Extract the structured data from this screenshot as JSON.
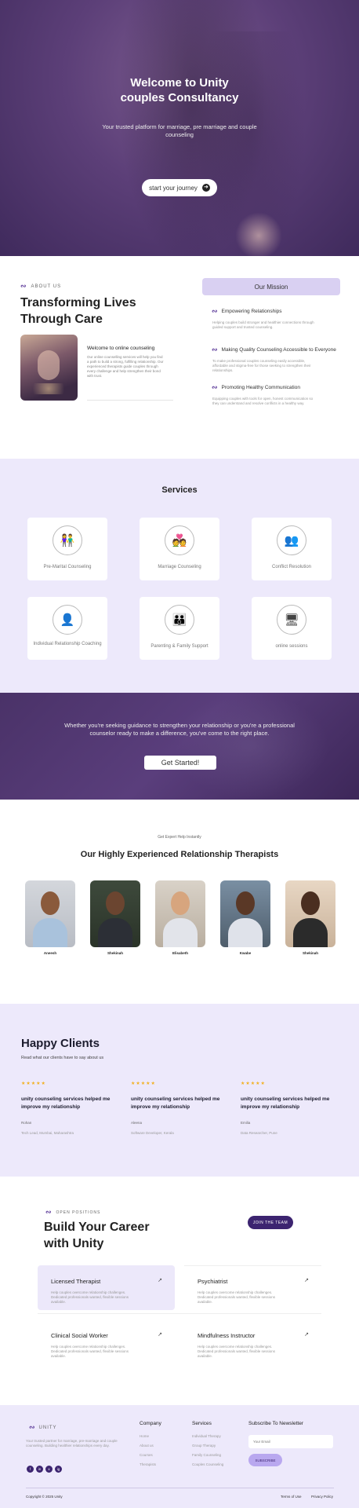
{
  "hero": {
    "title_line1": "Welcome to Unity",
    "title_line2": "couples Consultancy",
    "subtitle": "Your trusted platform for marriage, pre marriage and couple counseling",
    "cta_label": "start your journey",
    "cta_icon": "arrow-right-icon"
  },
  "about": {
    "tag": "ABOUT US",
    "title_line1": "Transforming Lives",
    "title_line2": "Through Care",
    "subheading": "Welcome to online counseling",
    "body": "Our online counselling services will help you find a path to build a strong, fulfilling relationship. Our experienced therapists guide couples through every challenge and help strengthen their bond with trust.",
    "mission_label": "Our Mission",
    "mission_items": [
      {
        "title": "Empowering Relationships",
        "text": "Helping couples build stronger and healthier connections through guided support and trusted counseling."
      },
      {
        "title": "Making Quality Counseling Accessible to Everyone",
        "text": "To make professional couples counseling easily accessible, affordable and stigma-free for those seeking to strengthen their relationships."
      },
      {
        "title": "Promoting Healthy Communication",
        "text": "Equipping couples with tools for open, honest communication so they can understand and resolve conflicts in a healthy way."
      }
    ]
  },
  "services": {
    "title": "Services",
    "items": [
      {
        "label": "Pre-Marital Counseling",
        "icon": "couple-icon"
      },
      {
        "label": "Marriage Counseling",
        "icon": "couple-rings-icon"
      },
      {
        "label": "Conflict Resolution",
        "icon": "conflict-icon"
      },
      {
        "label": "Individual Relationship Coaching",
        "icon": "person-icon"
      },
      {
        "label": "Parenting & Family Support",
        "icon": "family-icon"
      },
      {
        "label": "online sessions",
        "icon": "video-call-icon"
      }
    ]
  },
  "cta_banner": {
    "text": "Whether you're seeking guidance to strengthen your relationship or you're a professional counselor ready to make a difference, you've come to the right place.",
    "button": "Get Started!"
  },
  "therapists": {
    "tag": "Get Expert Help Instantly",
    "title": "Our Highly Experienced Relationship Therapists",
    "items": [
      {
        "name": "Aneesh"
      },
      {
        "name": "Shekinah"
      },
      {
        "name": "Elisabeth"
      },
      {
        "name": "Kwabe"
      },
      {
        "name": "Shekinah"
      }
    ]
  },
  "clients": {
    "title": "Happy Clients",
    "subtitle": "Read what our clients have to say about us",
    "reviews": [
      {
        "stars": "★★★★★",
        "title": "unity counseling services helped me improve my relationship",
        "name": "Rohan",
        "location": "Tech Lead, Mumbai, Maharashtra"
      },
      {
        "stars": "★★★★★",
        "title": "unity counseling services helped me improve my relationship",
        "name": "Aleena",
        "location": "Software Developer, Kerala"
      },
      {
        "stars": "★★★★★",
        "title": "unity counseling services helped me improve my relationship",
        "name": "Emilia",
        "location": "Data Researcher, Pune"
      }
    ]
  },
  "careers": {
    "tag": "OPEN POSITIONS",
    "title_line1": "Build Your Career",
    "title_line2": "with Unity",
    "button": "JOIN THE TEAM",
    "jobs": [
      {
        "title": "Licensed Therapist",
        "text": "Help couples overcome relationship challenges. Dedicated professionals wanted, flexible sessions available."
      },
      {
        "title": "Psychiatrist",
        "text": "Help couples overcome relationship challenges. Dedicated professionals wanted, flexible sessions available."
      },
      {
        "title": "Clinical Social Worker",
        "text": "Help couples overcome relationship challenges. Dedicated professionals wanted, flexible sessions available."
      },
      {
        "title": "Mindfulness Instructor",
        "text": "Help couples overcome relationship challenges. Dedicated professionals wanted, flexible sessions available."
      }
    ],
    "arrow_icon": "arrow-up-right-icon"
  },
  "footer": {
    "brand": "UNITY",
    "description": "Your trusted partner for marriage, pre-marriage and couple counseling. Building healthier relationships every day.",
    "social": [
      "f",
      "in",
      "x",
      "ig"
    ],
    "company": {
      "title": "Company",
      "links": [
        "Home",
        "About us",
        "Courses",
        "Therapists"
      ]
    },
    "services": {
      "title": "Services",
      "links": [
        "Individual Therapy",
        "Group Therapy",
        "Family Counseling",
        "Couples Counseling"
      ]
    },
    "newsletter": {
      "title": "Subscribe To Newsletter",
      "placeholder": "Your Email",
      "button": "SUBSCRIBE"
    },
    "copyright": "Copyright © 2025 Unity",
    "terms": "Terms of Use",
    "privacy": "Privacy Policy"
  },
  "colors": {
    "accent": "#3c2470",
    "lavender_bg": "#ede9fb",
    "mission_bg": "#d9d0f2",
    "stars": "#f2b01e"
  }
}
